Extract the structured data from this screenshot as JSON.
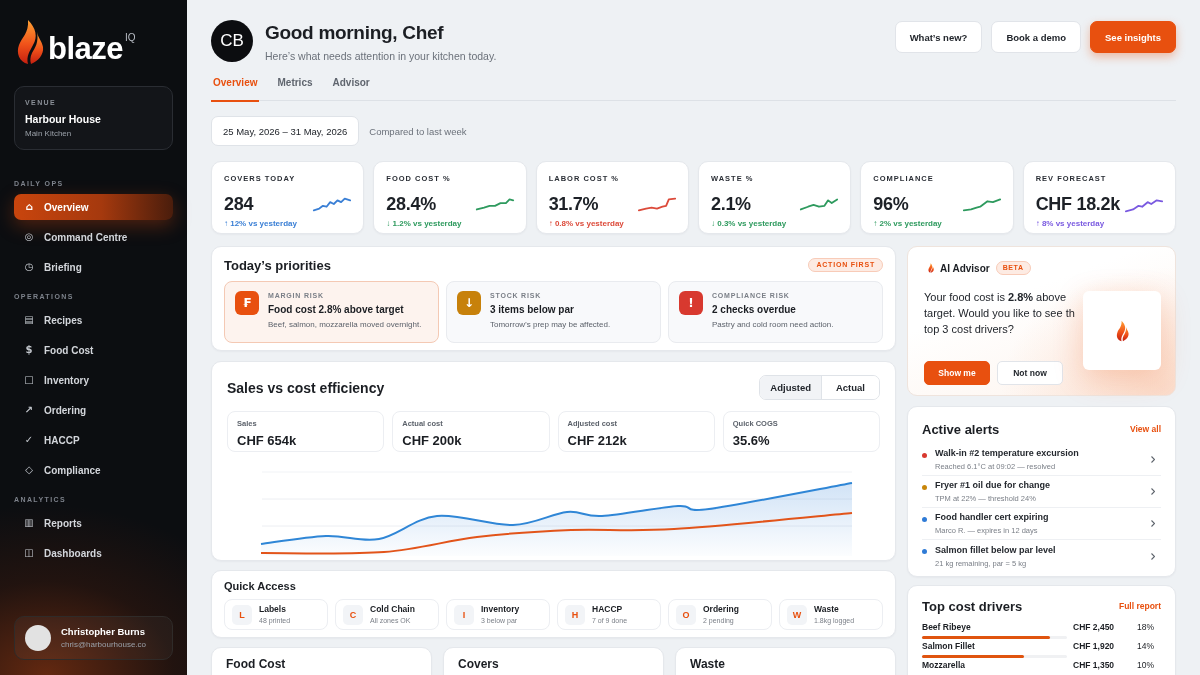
{
  "sidebar": {
    "logo": {
      "name": "blaze",
      "suffix": "IQ"
    },
    "venue": {
      "label": "VENUE",
      "name": "Harbour House",
      "sublabel": "Main Kitchen"
    },
    "sections": [
      {
        "title": "DAILY OPS",
        "items": [
          {
            "icon": "⌂",
            "label": "Overview",
            "selected": true
          },
          {
            "icon": "◎",
            "label": "Command Centre",
            "selected": false
          },
          {
            "icon": "◷",
            "label": "Briefing",
            "selected": false
          }
        ]
      },
      {
        "title": "OPERATIONS",
        "items": [
          {
            "icon": "▤",
            "label": "Recipes",
            "selected": false
          },
          {
            "icon": "$",
            "label": "Food Cost",
            "selected": false
          },
          {
            "icon": "□",
            "label": "Inventory",
            "selected": false
          },
          {
            "icon": "↗",
            "label": "Ordering",
            "selected": false
          },
          {
            "icon": "✓",
            "label": "HACCP",
            "selected": false
          },
          {
            "icon": "◇",
            "label": "Compliance",
            "selected": false
          }
        ]
      },
      {
        "title": "ANALYTICS",
        "items": [
          {
            "icon": "▥",
            "label": "Reports",
            "selected": false
          },
          {
            "icon": "◫",
            "label": "Dashboards",
            "selected": false
          }
        ]
      }
    ],
    "user": {
      "name": "Christopher Burns",
      "email": "chris@harbourhouse.co"
    }
  },
  "header": {
    "avatar": "CB",
    "title": "Good morning, Chef",
    "subtitle": "Here’s what needs attention in your kitchen today.",
    "buttons": [
      {
        "label": "What’s new?",
        "kind": "secondary"
      },
      {
        "label": "Book a demo",
        "kind": "secondary"
      },
      {
        "label": "See insights",
        "kind": "primary"
      }
    ]
  },
  "tabs": [
    {
      "label": "Overview",
      "selected": true
    },
    {
      "label": "Metrics",
      "selected": false
    },
    {
      "label": "Advisor",
      "selected": false
    }
  ],
  "date_range": {
    "value": "25 May, 2026 – 31 May, 2026",
    "comparison": "Compared to last week"
  },
  "kpis": [
    {
      "label": "COVERS TODAY",
      "value": "284",
      "delta": "↑ 12% vs yesterday",
      "color": "#3a7fd5"
    },
    {
      "label": "FOOD COST %",
      "value": "28.4%",
      "delta": "↓ 1.2% vs yesterday",
      "color": "#2e9a5e"
    },
    {
      "label": "LABOR COST %",
      "value": "31.7%",
      "delta": "↑ 0.8% vs yesterday",
      "color": "#dc4a3a"
    },
    {
      "label": "WASTE %",
      "value": "2.1%",
      "delta": "↓ 0.3% vs yesterday",
      "color": "#2e9a5e"
    },
    {
      "label": "COMPLIANCE",
      "value": "96%",
      "delta": "↑ 2% vs yesterday",
      "color": "#2e9a5e"
    },
    {
      "label": "REV FORECAST",
      "value": "CHF 18.2k",
      "delta": "↑ 8% vs yesterday",
      "color": "#7a5ae0"
    }
  ],
  "priorities": {
    "title": "Today’s priorities",
    "badge": "ACTION FIRST",
    "items": [
      {
        "icon": "₣",
        "category": "MARGIN RISK",
        "title": "Food cost 2.8% above target",
        "detail": "Beef, salmon, mozzarella moved overnight.",
        "color": "#e8500f",
        "highlighted": true
      },
      {
        "icon": "↓",
        "category": "STOCK RISK",
        "title": "3 items below par",
        "detail": "Tomorrow’s prep may be affected.",
        "color": "#c7810b",
        "highlighted": false
      },
      {
        "icon": "!",
        "category": "COMPLIANCE RISK",
        "title": "2 checks overdue",
        "detail": "Pastry and cold room need action.",
        "color": "#d8392f",
        "highlighted": false
      }
    ]
  },
  "sales": {
    "title": "Sales vs cost efficiency",
    "toggle": [
      {
        "label": "Adjusted",
        "selected": true
      },
      {
        "label": "Actual",
        "selected": false
      }
    ],
    "stats": [
      {
        "label": "Sales",
        "value": "CHF 654k"
      },
      {
        "label": "Actual cost",
        "value": "CHF 200k"
      },
      {
        "label": "Adjusted cost",
        "value": "CHF 212k"
      },
      {
        "label": "Quick COGS",
        "value": "35.6%"
      }
    ]
  },
  "quick_access": {
    "title": "Quick Access",
    "items": [
      {
        "letter": "L",
        "label": "Labels",
        "detail": "48 printed"
      },
      {
        "letter": "C",
        "label": "Cold Chain",
        "detail": "All zones OK"
      },
      {
        "letter": "I",
        "label": "Inventory",
        "detail": "3 below par"
      },
      {
        "letter": "H",
        "label": "HACCP",
        "detail": "7 of 9 done"
      },
      {
        "letter": "O",
        "label": "Ordering",
        "detail": "2 pending"
      },
      {
        "letter": "W",
        "label": "Waste",
        "detail": "1.8kg logged"
      }
    ]
  },
  "bottom_cards": [
    {
      "title": "Food Cost"
    },
    {
      "title": "Covers"
    },
    {
      "title": "Waste"
    }
  ],
  "advisor": {
    "title": "AI Advisor",
    "badge": "BETA",
    "message": "Your food cost is **2.8%** above\ntarget. Would you like to see th\ntop 3 cost drivers?",
    "actions": [
      {
        "label": "Show me",
        "kind": "primary"
      },
      {
        "label": "Not now",
        "kind": "secondary"
      }
    ]
  },
  "alerts": {
    "title": "Active alerts",
    "link": "View all",
    "items": [
      {
        "title": "Walk-in #2 temperature excursion",
        "detail": "Reached 6.1°C at 09:02 — resolved",
        "color": "#d8392f"
      },
      {
        "title": "Fryer #1 oil due for change",
        "detail": "TPM at 22% — threshold 24%",
        "color": "#c8860a"
      },
      {
        "title": "Food handler cert expiring",
        "detail": "Marco R. — expires in 12 days",
        "color": "#2f7bd6"
      },
      {
        "title": "Salmon fillet below par level",
        "detail": "21 kg remaining, par = 5 kg",
        "color": "#2f7bd6"
      }
    ]
  },
  "cost_drivers": {
    "title": "Top cost drivers",
    "link": "Full report",
    "items": [
      {
        "name": "Beef Ribeye",
        "amount": "CHF 2,450",
        "share": "18%",
        "level": 0.88
      },
      {
        "name": "Salmon Fillet",
        "amount": "CHF 1,920",
        "share": "14%",
        "level": 0.7
      },
      {
        "name": "Mozzarella",
        "amount": "CHF 1,350",
        "share": "10%"
      }
    ]
  }
}
